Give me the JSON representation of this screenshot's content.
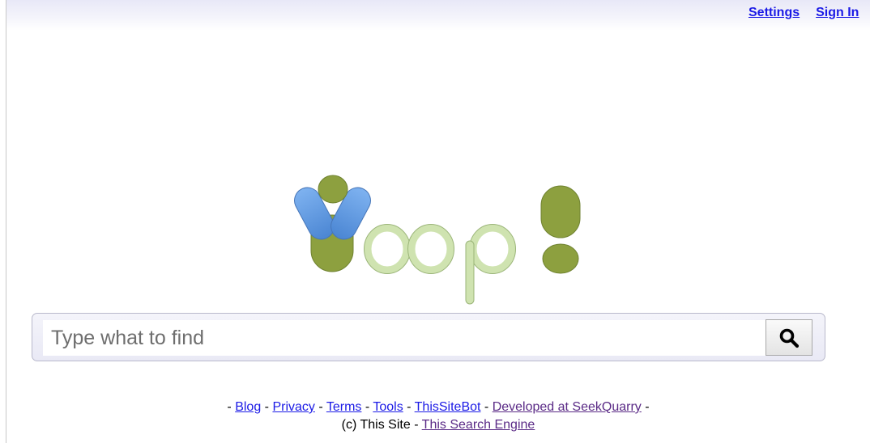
{
  "header": {
    "settings_label": "Settings",
    "signin_label": "Sign In"
  },
  "search": {
    "placeholder": "Type what to find",
    "value": ""
  },
  "footer": {
    "sep": "-",
    "links": {
      "blog": "Blog",
      "privacy": "Privacy",
      "terms": "Terms",
      "tools": "Tools",
      "bot": "ThisSiteBot",
      "developed": "Developed at SeekQuarry"
    },
    "copyright": "(c) This Site",
    "engine_link": "This Search Engine"
  },
  "icons": {
    "logo": "yioop-logo",
    "search": "search-icon"
  },
  "colors": {
    "link": "#1b1ae6",
    "visited_link": "#5a2a86",
    "logo_green_dark": "#8da03f",
    "logo_green_light": "#cfe3b0",
    "logo_blue": "#5b95dc"
  }
}
